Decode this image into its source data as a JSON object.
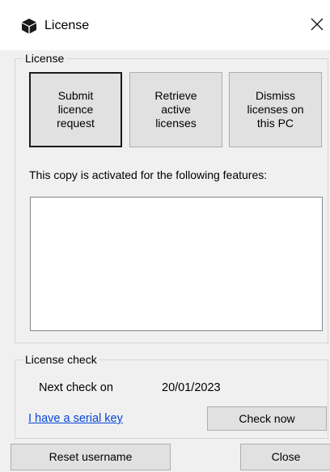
{
  "window": {
    "title": "License",
    "close_glyph": "✕"
  },
  "license_group": {
    "legend": "License",
    "buttons": {
      "submit": "Submit\nlicence\nrequest",
      "retrieve": "Retrieve\nactive\nlicenses",
      "dismiss": "Dismiss\nlicenses on\nthis PC"
    },
    "features_label": "This copy is activated for the following features:",
    "features_items": []
  },
  "check_group": {
    "legend": "License check",
    "next_check_label": "Next check on",
    "next_check_date": "20/01/2023",
    "serial_link": "I have a serial key",
    "check_now_button": "Check now"
  },
  "footer": {
    "reset_button": "Reset username",
    "close_button": "Close"
  },
  "icons": {
    "app": "cube-icon",
    "close": "close-icon"
  }
}
